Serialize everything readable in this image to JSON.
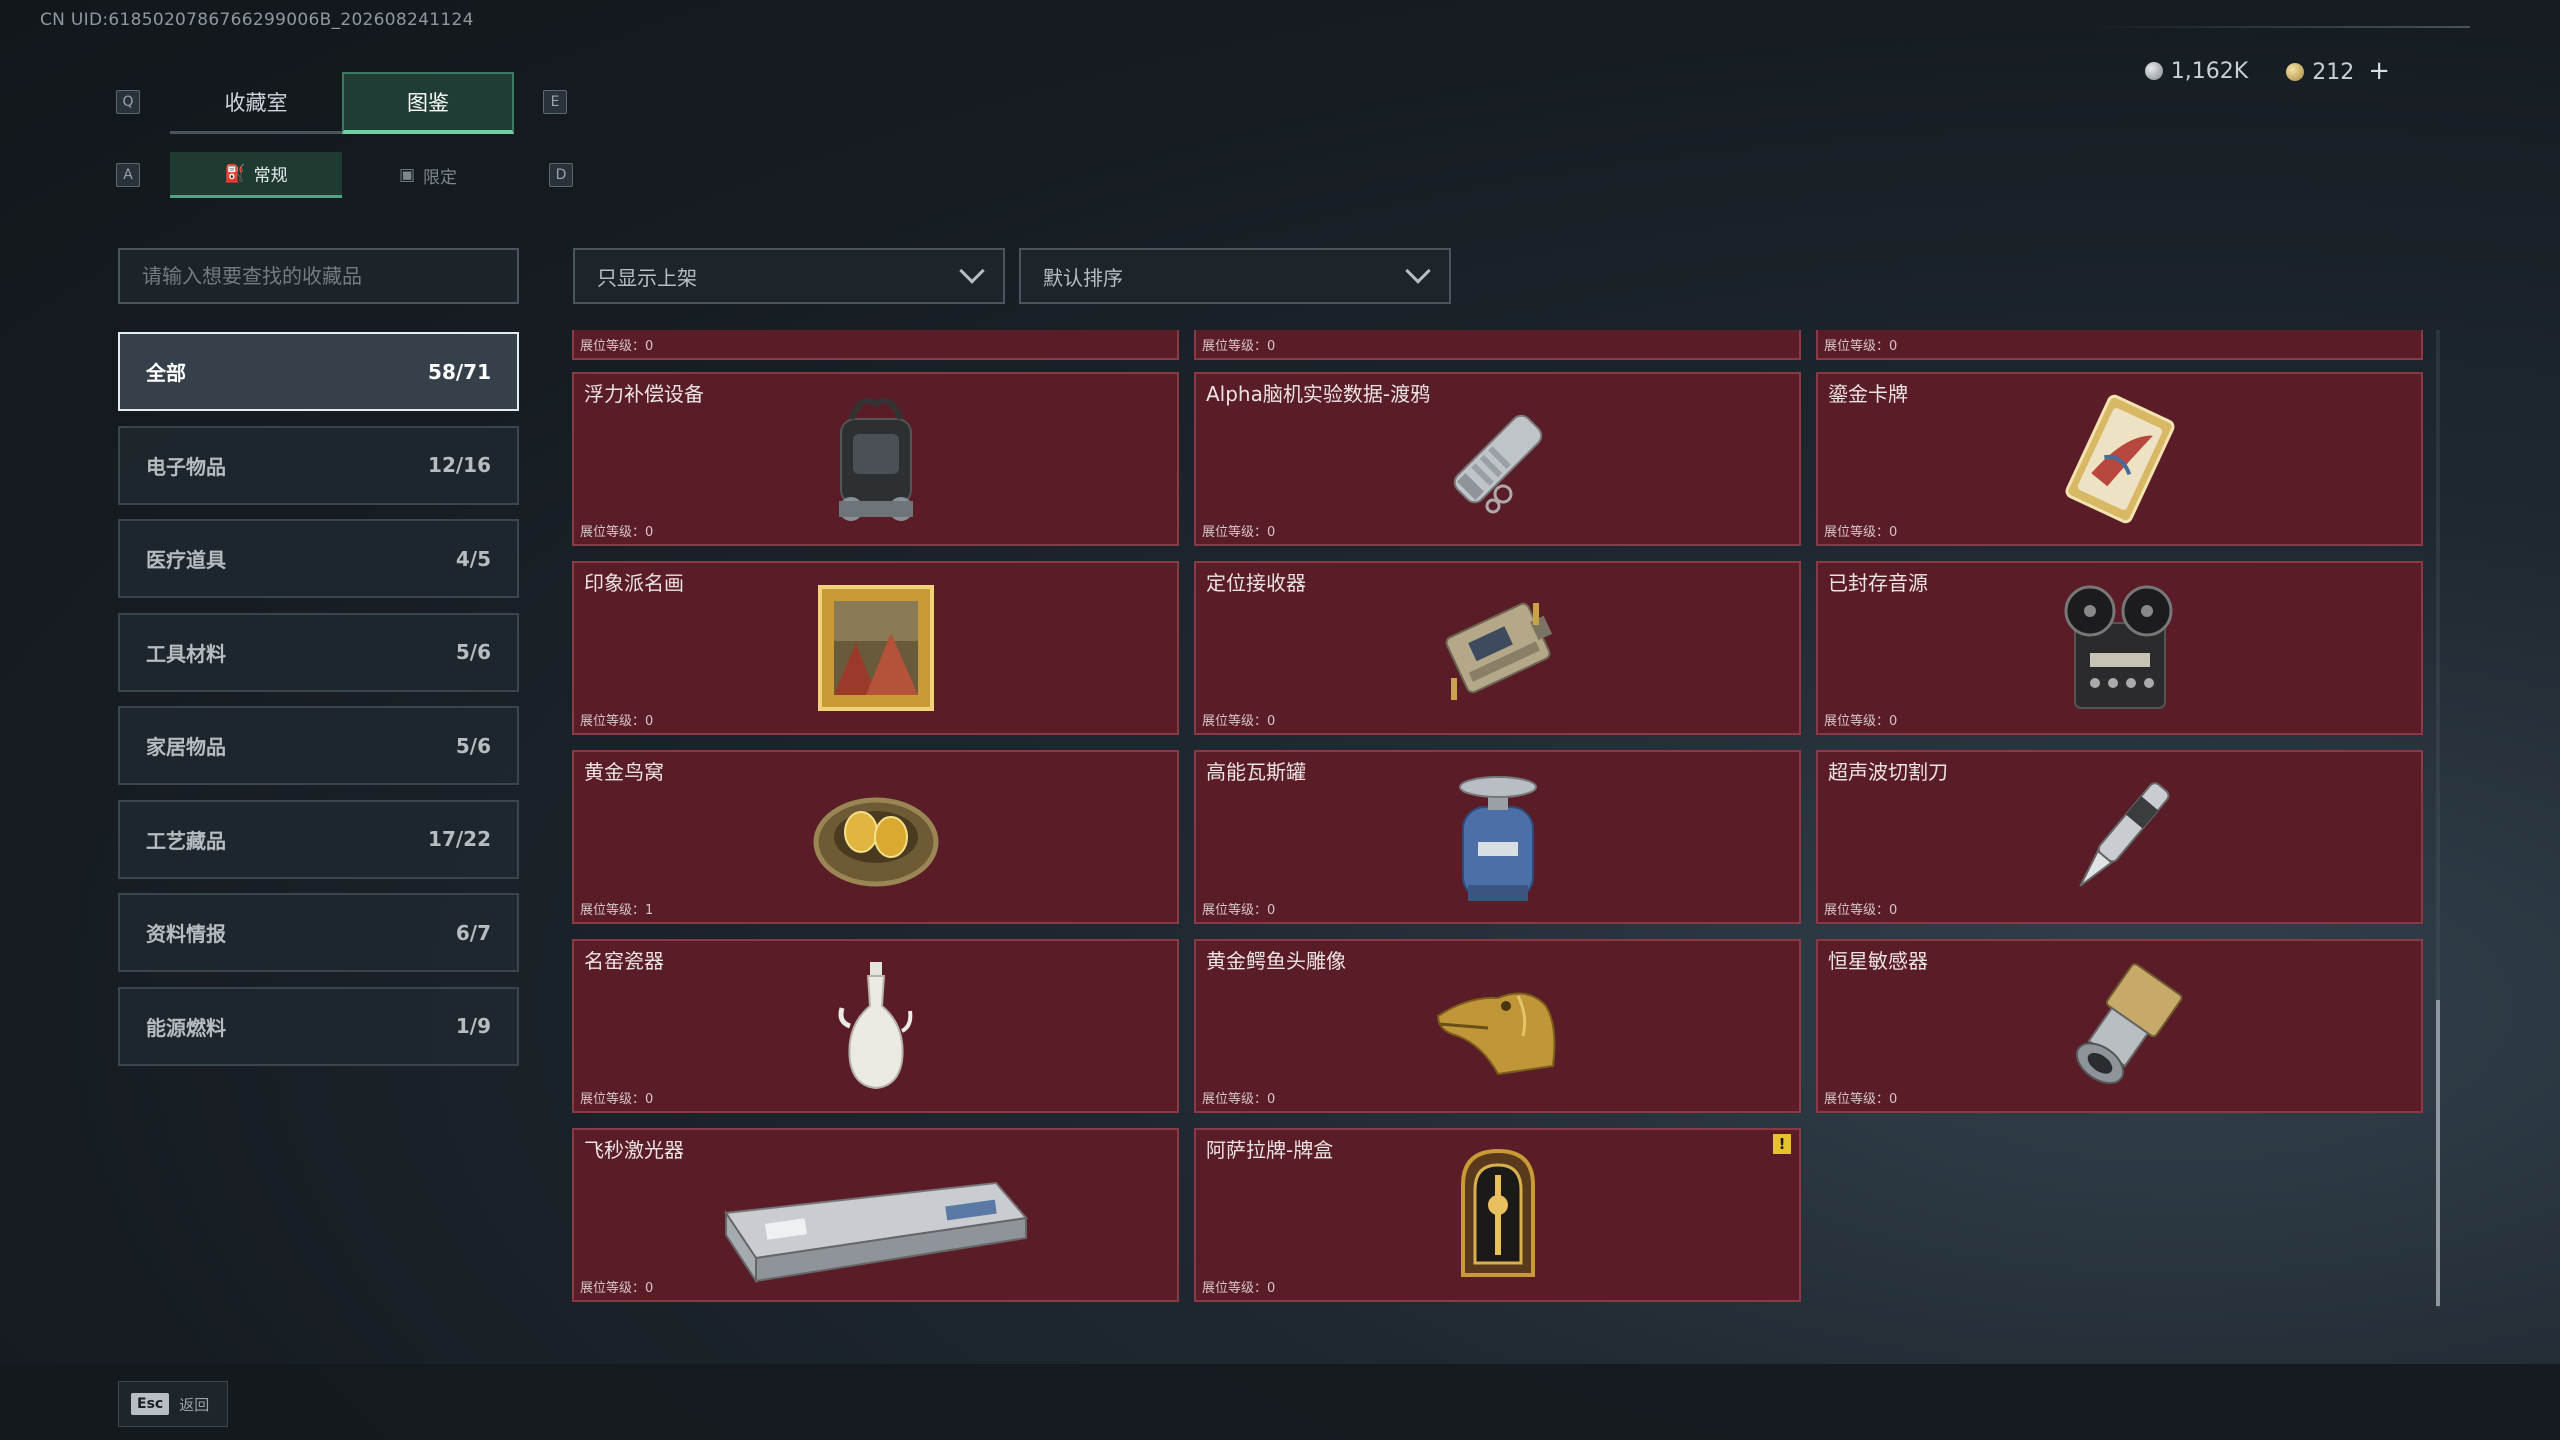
{
  "uid_text": "CN UID:6185020786766299006B_202608241124",
  "keys": {
    "q": "Q",
    "e": "E",
    "a": "A",
    "d": "D"
  },
  "main_tabs": [
    {
      "label": "收藏室",
      "active": false
    },
    {
      "label": "图鉴",
      "active": true
    }
  ],
  "sub_tabs": [
    {
      "label": "常规",
      "active": true
    },
    {
      "label": "限定",
      "active": false
    }
  ],
  "currency": {
    "silver": "1,162K",
    "gold": "212",
    "plus": "+"
  },
  "search": {
    "placeholder": "请输入想要查找的收藏品"
  },
  "filters": {
    "shelf": "只显示上架",
    "sort": "默认排序"
  },
  "categories": [
    {
      "label": "全部",
      "count": "58/71",
      "active": true
    },
    {
      "label": "电子物品",
      "count": "12/16"
    },
    {
      "label": "医疗道具",
      "count": "4/5"
    },
    {
      "label": "工具材料",
      "count": "5/6"
    },
    {
      "label": "家居物品",
      "count": "5/6"
    },
    {
      "label": "工艺藏品",
      "count": "17/22"
    },
    {
      "label": "资料情报",
      "count": "6/7"
    },
    {
      "label": "能源燃料",
      "count": "1/9"
    }
  ],
  "level_prefix": "展位等级：",
  "items": [
    {
      "name": "",
      "level": "0",
      "icon": "partial-item-icon"
    },
    {
      "name": "",
      "level": "0",
      "icon": "partial-item-icon"
    },
    {
      "name": "",
      "level": "0",
      "icon": "partial-item-icon"
    },
    {
      "name": "浮力补偿设备",
      "level": "0",
      "icon": "bcd-backpack-icon"
    },
    {
      "name": "Alpha脑机实验数据-渡鸦",
      "level": "0",
      "icon": "data-cylinder-icon"
    },
    {
      "name": "鎏金卡牌",
      "level": "0",
      "icon": "gilded-card-icon"
    },
    {
      "name": "印象派名画",
      "level": "0",
      "icon": "painting-icon"
    },
    {
      "name": "定位接收器",
      "level": "0",
      "icon": "gps-receiver-icon"
    },
    {
      "name": "已封存音源",
      "level": "0",
      "icon": "reel-recorder-icon"
    },
    {
      "name": "黄金鸟窝",
      "level": "1",
      "icon": "golden-nest-icon"
    },
    {
      "name": "高能瓦斯罐",
      "level": "0",
      "icon": "gas-canister-icon"
    },
    {
      "name": "超声波切割刀",
      "level": "0",
      "icon": "ultrasonic-cutter-icon"
    },
    {
      "name": "名窑瓷器",
      "level": "0",
      "icon": "porcelain-vase-icon"
    },
    {
      "name": "黄金鳄鱼头雕像",
      "level": "0",
      "icon": "croc-statue-icon"
    },
    {
      "name": "恒星敏感器",
      "level": "0",
      "icon": "star-sensor-icon"
    },
    {
      "name": "飞秒激光器",
      "level": "0",
      "icon": "laser-case-icon"
    },
    {
      "name": "阿萨拉牌-牌盒",
      "level": "0",
      "icon": "card-box-icon",
      "alert": "!"
    }
  ],
  "footer": {
    "esc": "Esc",
    "back": "返回"
  }
}
